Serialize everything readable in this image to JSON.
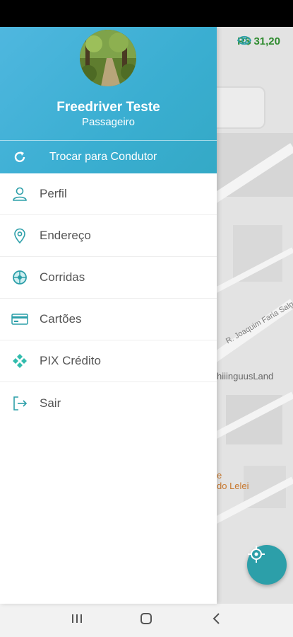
{
  "wallet": {
    "balance": "R$ 31,20"
  },
  "drawer": {
    "user_name": "Freedriver Teste",
    "user_role": "Passageiro",
    "switch_label": "Trocar para Condutor",
    "items": [
      {
        "label": "Perfil",
        "icon": "user-icon"
      },
      {
        "label": "Endereço",
        "icon": "location-pin-icon"
      },
      {
        "label": "Corridas",
        "icon": "steering-wheel-icon"
      },
      {
        "label": "Cartões",
        "icon": "credit-card-icon"
      },
      {
        "label": "PIX Crédito",
        "icon": "pix-icon"
      },
      {
        "label": "Sair",
        "icon": "logout-icon"
      }
    ]
  },
  "map": {
    "street": "R. Joaquim Faria Salgado",
    "place": "hiiinguusLand",
    "poi_line1": "e",
    "poi_line2": "do Lelei"
  },
  "colors": {
    "accent": "#2c9fa9",
    "header": "#3aaed1",
    "balance": "#2e8b2e"
  }
}
